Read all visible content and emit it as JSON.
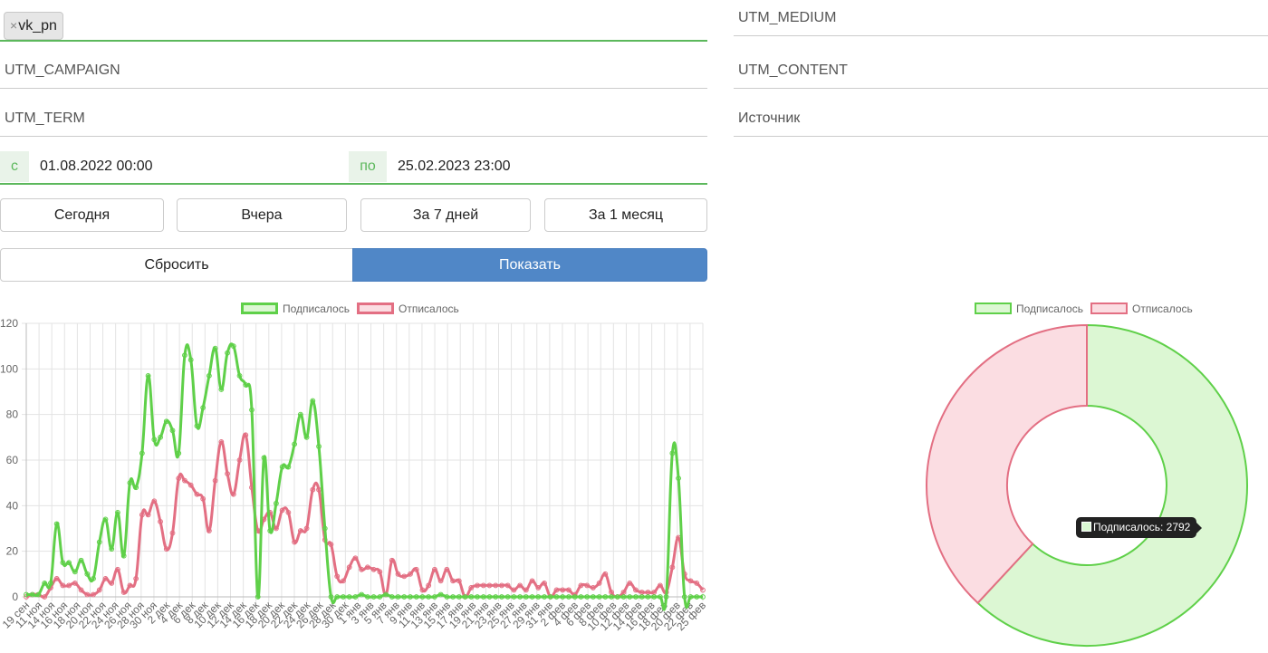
{
  "filters": {
    "source_tag": "vk_pn",
    "utm_medium_placeholder": "UTM_MEDIUM",
    "utm_campaign_placeholder": "UTM_CAMPAIGN",
    "utm_content_placeholder": "UTM_CONTENT",
    "utm_term_placeholder": "UTM_TERM",
    "source_placeholder": "Источник",
    "from_prefix": "с",
    "from_value": "01.08.2022 00:00",
    "to_prefix": "по",
    "to_value": "25.02.2023 23:00"
  },
  "buttons": {
    "today": "Сегодня",
    "yesterday": "Вчера",
    "week": "За 7 дней",
    "month": "За 1 месяц",
    "reset": "Сбросить",
    "show": "Показать"
  },
  "colors": {
    "subscribed_line": "#5fd049",
    "subscribed_fill": "#dcf7d3",
    "unsubscribed_line": "#e36f83",
    "unsubscribed_fill": "#fbdde2",
    "primary": "#5087c7",
    "accent_green": "#5cb85c"
  },
  "tooltip": {
    "text": "Подписалось: 2792"
  },
  "chart_data": [
    {
      "type": "line",
      "legend": [
        "Подписалось",
        "Отписалось"
      ],
      "legend_position": "top",
      "grid": true,
      "ylim": [
        0,
        120
      ],
      "yticks": [
        0,
        20,
        40,
        60,
        80,
        100,
        120
      ],
      "x_tick_labels": [
        "19 сен",
        "11 ноя",
        "14 ноя",
        "16 ноя",
        "18 ноя",
        "20 ноя",
        "22 ноя",
        "24 ноя",
        "26 ноя",
        "28 ноя",
        "30 ноя",
        "2 дек",
        "4 дек",
        "6 дек",
        "8 дек",
        "10 дек",
        "12 дек",
        "14 дек",
        "16 дек",
        "18 дек",
        "20 дек",
        "22 дек",
        "24 дек",
        "26 дек",
        "28 дек",
        "30 дек",
        "1 янв",
        "3 янв",
        "5 янв",
        "7 янв",
        "9 янв",
        "11 янв",
        "13 янв",
        "15 янв",
        "17 янв",
        "19 янв",
        "21 янв",
        "23 янв",
        "25 янв",
        "27 янв",
        "29 янв",
        "31 янв",
        "2 фев",
        "4 фев",
        "6 фев",
        "8 фев",
        "10 фев",
        "12 фев",
        "14 фев",
        "16 фев",
        "18 фев",
        "20 фев",
        "22 фев",
        "25 фев"
      ],
      "series": [
        {
          "name": "Подписалось",
          "values": [
            1,
            1,
            1,
            6,
            6,
            32,
            15,
            15,
            11,
            16,
            10,
            8,
            24,
            34,
            21,
            37,
            18,
            50,
            48,
            63,
            97,
            69,
            70,
            77,
            73,
            63,
            106,
            104,
            75,
            83,
            97,
            109,
            91,
            107,
            110,
            97,
            93,
            82,
            0,
            61,
            29,
            41,
            57,
            57,
            67,
            80,
            70,
            86,
            66,
            30,
            0,
            0,
            0,
            0,
            0,
            1,
            0,
            0,
            0,
            1,
            0,
            0,
            0,
            0,
            0,
            0,
            0,
            0,
            1,
            0,
            0,
            0,
            0,
            0,
            0,
            0,
            0,
            0,
            0,
            0,
            0,
            0,
            0,
            0,
            0,
            0,
            0,
            0,
            0,
            0,
            0,
            0,
            0,
            0,
            0,
            0,
            0,
            0,
            0,
            0,
            0,
            0,
            0,
            0,
            0,
            0,
            63,
            52,
            0,
            0,
            0,
            0
          ]
        },
        {
          "name": "Отписалось",
          "values": [
            0,
            1,
            1,
            0,
            4,
            8,
            5,
            5,
            6,
            3,
            1,
            1,
            3,
            8,
            6,
            12,
            2,
            5,
            8,
            36,
            36,
            42,
            33,
            21,
            28,
            52,
            51,
            49,
            45,
            43,
            29,
            51,
            68,
            54,
            45,
            60,
            71,
            48,
            29,
            34,
            37,
            30,
            38,
            37,
            24,
            29,
            30,
            47,
            47,
            25,
            23,
            9,
            7,
            13,
            17,
            12,
            13,
            12,
            11,
            1,
            16,
            10,
            9,
            10,
            12,
            3,
            5,
            12,
            7,
            12,
            7,
            7,
            0,
            4,
            5,
            5,
            5,
            5,
            5,
            5,
            3,
            5,
            3,
            7,
            4,
            6,
            0,
            3,
            3,
            3,
            1,
            5,
            5,
            4,
            6,
            10,
            2,
            0,
            2,
            6,
            3,
            2,
            2,
            2,
            5,
            2,
            13,
            26,
            10,
            7,
            6,
            3
          ]
        }
      ]
    },
    {
      "type": "pie",
      "variant": "doughnut",
      "legend": [
        "Подписалось",
        "Отписалось"
      ],
      "legend_position": "top",
      "slices": [
        {
          "name": "Подписалось",
          "value": 2792
        },
        {
          "name": "Отписалось",
          "value": 1718
        }
      ]
    }
  ]
}
